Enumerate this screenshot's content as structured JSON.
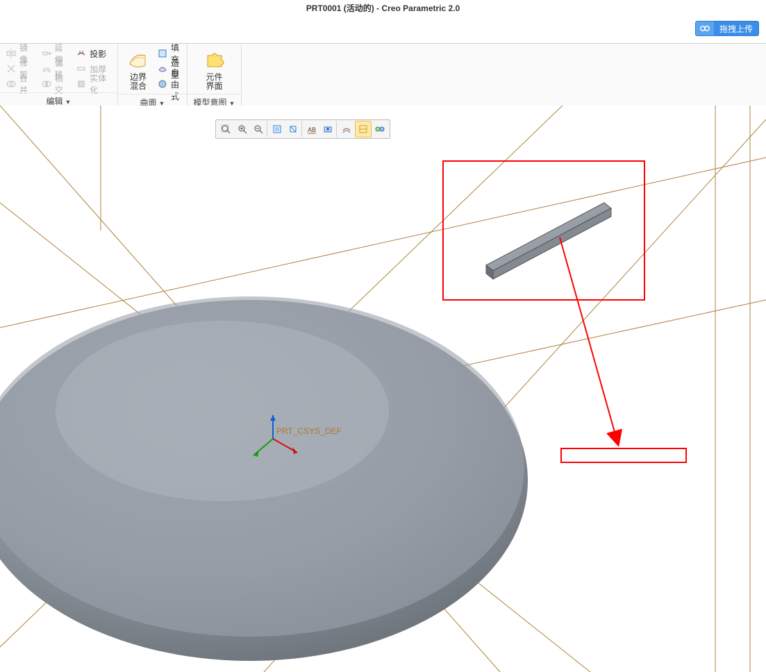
{
  "title": "PRT0001 (活动的) - Creo Parametric 2.0",
  "upload_button": "拖拽上传",
  "ribbon": {
    "edit_panel": {
      "label": "编辑",
      "mirror": "镜像",
      "trim": "修剪",
      "merge": "合并",
      "extend": "延伸",
      "offset": "偏移",
      "intersect": "相交",
      "project": "投影",
      "thicken": "加厚",
      "solidify": "实体化"
    },
    "surface_panel": {
      "label": "曲面",
      "boundary_blend": "边界\n混合",
      "fill": "填充",
      "style": "造型",
      "freestyle": "自由式"
    },
    "intent_panel": {
      "label": "模型意图",
      "component_interface": "元件\n界面"
    }
  },
  "toolbar": {
    "zoom_window": "zoom-window",
    "zoom_in": "zoom-in",
    "zoom_out": "zoom-out",
    "refit": "refit",
    "repaint": "repaint",
    "annotations": "annotations",
    "saved_views": "saved-views",
    "display_style": "display-style",
    "datum_display": "datum-display",
    "planes": "planes"
  },
  "viewport": {
    "csys_label": "PRT_CSYS_DEF"
  }
}
